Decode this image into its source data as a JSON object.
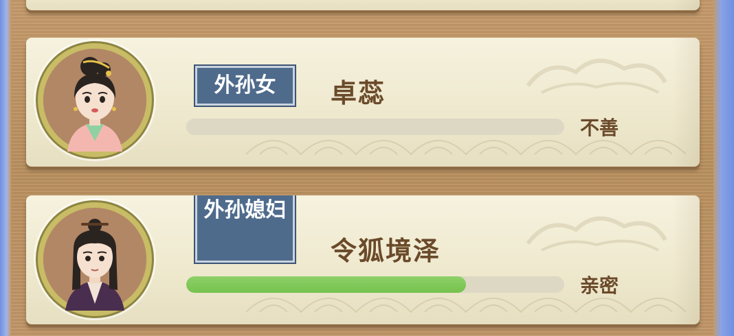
{
  "entries": [
    {
      "relation": "外孙女",
      "name": "卓蕊",
      "status": "不善",
      "affinity": 0,
      "avatar_icon": "female-portrait-icon"
    },
    {
      "relation": "外孙媳妇",
      "name": "令狐境泽",
      "status": "亲密",
      "affinity": 0.74,
      "avatar_icon": "male-portrait-icon"
    }
  ],
  "colors": {
    "tag_bg": "#4f6b8c",
    "bar_fill": "#75c24e",
    "bar_track": "#ddd8c4",
    "text_brown": "#6a4a2a"
  }
}
